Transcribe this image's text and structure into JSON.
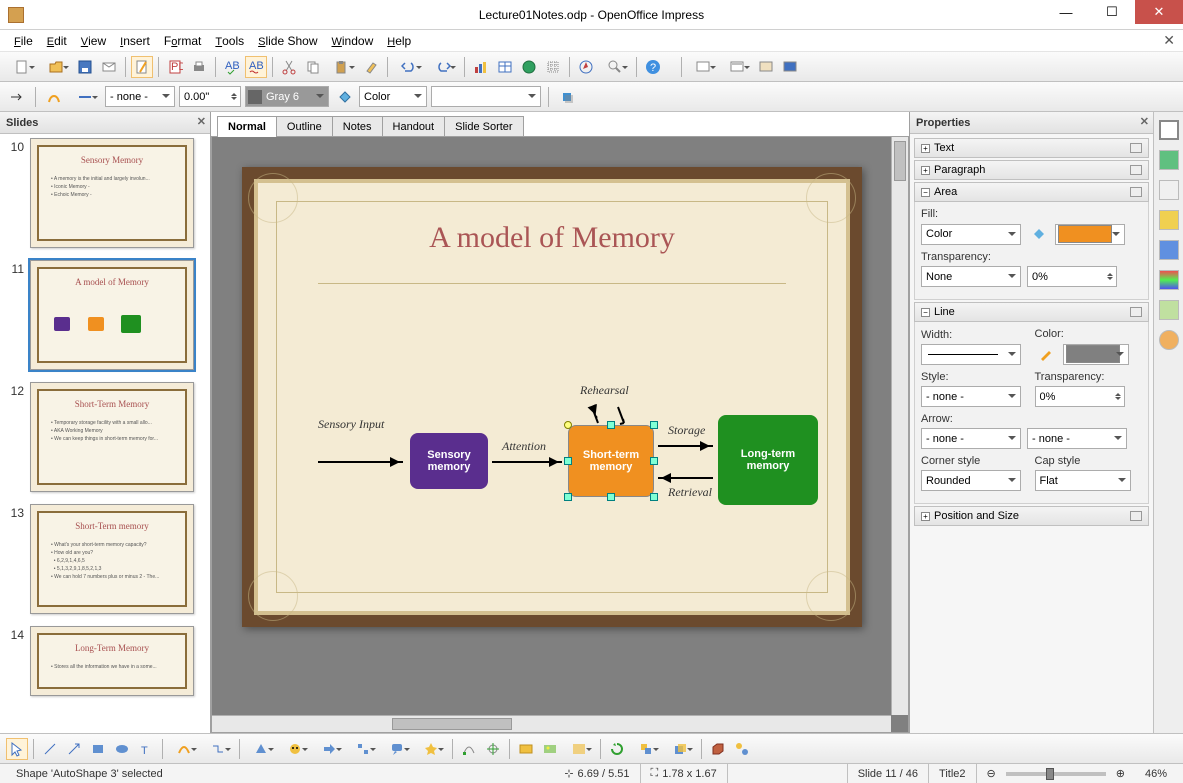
{
  "window": {
    "title": "Lecture01Notes.odp - OpenOffice Impress"
  },
  "menu": [
    "File",
    "Edit",
    "View",
    "Insert",
    "Format",
    "Tools",
    "Slide Show",
    "Window",
    "Help"
  ],
  "toolbar2": {
    "line_style": "- none -",
    "width": "0.00\"",
    "color_name": "Gray 6",
    "fill_type": "Color"
  },
  "slides_panel_title": "Slides",
  "thumbs": [
    {
      "n": "10",
      "title": "Sensory Memory"
    },
    {
      "n": "11",
      "title": "A model of Memory",
      "selected": true,
      "diagram": true
    },
    {
      "n": "12",
      "title": "Short-Term Memory"
    },
    {
      "n": "13",
      "title": "Short-Term memory"
    },
    {
      "n": "14",
      "title": "Long-Term Memory"
    }
  ],
  "view_tabs": [
    "Normal",
    "Outline",
    "Notes",
    "Handout",
    "Slide Sorter"
  ],
  "slide": {
    "title": "A model of Memory",
    "labels": {
      "sensory_input": "Sensory Input",
      "attention": "Attention",
      "rehearsal": "Rehearsal",
      "storage": "Storage",
      "retrieval": "Retrieval"
    },
    "boxes": {
      "sensory": "Sensory memory",
      "short": "Short-term memory",
      "long": "Long-term memory"
    }
  },
  "props": {
    "title": "Properties",
    "sections": {
      "text": "Text",
      "paragraph": "Paragraph",
      "area": "Area",
      "line": "Line",
      "pos": "Position and Size"
    },
    "area": {
      "fill_label": "Fill:",
      "fill_type": "Color",
      "transparency_label": "Transparency:",
      "transparency_mode": "None",
      "transparency_val": "0%"
    },
    "line": {
      "width_label": "Width:",
      "color_label": "Color:",
      "style_label": "Style:",
      "style_val": "- none -",
      "trans_label": "Transparency:",
      "trans_val": "0%",
      "arrow_label": "Arrow:",
      "arrow_left": "- none -",
      "arrow_right": "- none -",
      "corner_label": "Corner style",
      "corner_val": "Rounded",
      "cap_label": "Cap style",
      "cap_val": "Flat"
    }
  },
  "status": {
    "selection": "Shape 'AutoShape 3' selected",
    "pos": "6.69 / 5.51",
    "size": "1.78 x 1.67",
    "slide": "Slide 11 / 46",
    "template": "Title2",
    "zoom": "46%"
  }
}
